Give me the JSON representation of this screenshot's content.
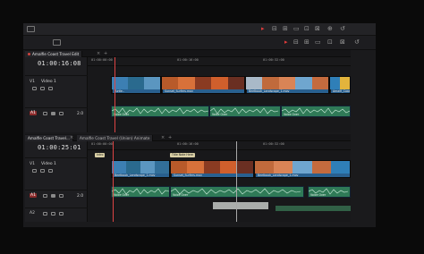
{
  "timeline_upper": {
    "tab_label": "Amalfie Coast Travel Edit",
    "timecode": "01:00:16:08",
    "ruler_labels": [
      "01:00:00:00",
      "01:00:16:00",
      "01:00:32:00"
    ],
    "video_track": {
      "id": "V1",
      "label": "Video 1"
    },
    "audio_track": {
      "id": "A1",
      "level": "2.0"
    },
    "video_clips": [
      "Turtle..",
      "Sunset_Surfers.mov",
      "Beetbook_Landscape_1.mov",
      "Amalfi_Coast"
    ],
    "audio_clips": [
      "Voice Over",
      "Voice Over",
      "Voice Over"
    ]
  },
  "timeline_lower": {
    "tabs": [
      "Amalfie Coast Travel...",
      "Amalfie Coast Travel (Union) Animate"
    ],
    "timecode": "01:00:25:01",
    "ruler_labels": [
      "01:00:00:00",
      "01:00:16:00",
      "01:00:32:00"
    ],
    "video_track": {
      "id": "V1",
      "label": "Video 1"
    },
    "audio_track": {
      "id": "A1",
      "level": "2.0"
    },
    "audio_track_2": {
      "id": "A2"
    },
    "markers": [
      "Intro",
      "Title Note Here"
    ],
    "video_clips": [
      "Beetbook_Landscape_1.mov",
      "Sunset_Surfers.mov",
      "Beetbook_Landscape_1.mov"
    ],
    "audio_clips": [
      "Voice Over",
      "Voice Over",
      "Voice Over"
    ]
  },
  "colors": {
    "video_clip_bar": "#29608f",
    "audio_clip": "#2f7a57",
    "playhead": "#dd4444",
    "record_accent": "#e23b3b"
  },
  "icons": [
    "window-menu-icon",
    "grid-icon",
    "record-icon",
    "settings-icon",
    "undo-icon"
  ]
}
